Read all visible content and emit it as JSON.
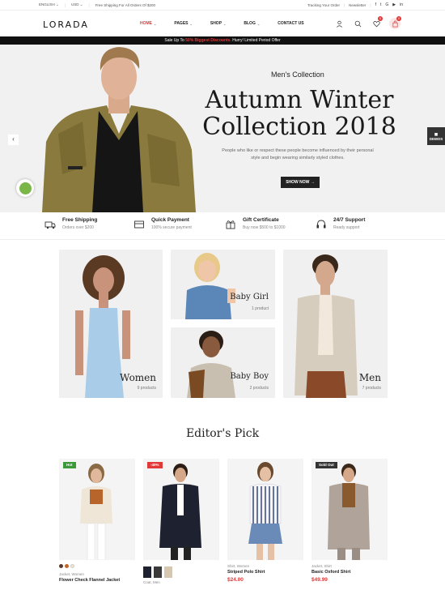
{
  "topbar": {
    "language": "ENGLISH",
    "currency": "USD",
    "shipping_note": "Free Shipping For All Orders Of $200",
    "tracking": "Tracking Your Order",
    "newsletter": "Newsletter",
    "social": [
      "f",
      "t",
      "G",
      "▶",
      "in"
    ]
  },
  "header": {
    "logo": "LORADA",
    "nav": [
      {
        "label": "HOME",
        "active": true
      },
      {
        "label": "PAGES"
      },
      {
        "label": "SHOP"
      },
      {
        "label": "BLOG"
      },
      {
        "label": "CONTACT US"
      }
    ],
    "wishlist_count": "0",
    "cart_count": "0"
  },
  "promo": {
    "prefix": "Sale Up To ",
    "highlight": "50% Biggest Discounts.",
    "suffix": " Hurry! Limited Period Offer"
  },
  "hero": {
    "subtitle": "Men's Collection",
    "title_line1": "Autumn Winter",
    "title_line2": "Collection 2018",
    "description": "People who like or respect these people become influenced by their personal style and begin wearing similarly styled clothes.",
    "button": "SHOW NOW →",
    "demos": "DEMOS"
  },
  "features": [
    {
      "title": "Free Shipping",
      "desc": "Orders over $200",
      "icon": "truck-icon"
    },
    {
      "title": "Quick Payment",
      "desc": "100% secure payment",
      "icon": "payment-icon"
    },
    {
      "title": "Gift Certificate",
      "desc": "Buy now $500 to $1000",
      "icon": "gift-icon"
    },
    {
      "title": "24/7 Support",
      "desc": "Ready support",
      "icon": "headset-icon"
    }
  ],
  "categories": {
    "women": {
      "label": "Women",
      "count": "9 products"
    },
    "baby_girl": {
      "label": "Baby Girl",
      "count": "1 product"
    },
    "baby_boy": {
      "label": "Baby Boy",
      "count": "2 products"
    },
    "men": {
      "label": "Men",
      "count": "7 products"
    }
  },
  "editors_pick": {
    "title": "Editor's Pick",
    "products": [
      {
        "tag": "Hot",
        "tag_color": "#3a9a3a",
        "cats": "Jacket, Women",
        "name": "Flower Check Flannel Jacket",
        "price": ""
      },
      {
        "tag": "-40%",
        "tag_color": "#e13838",
        "cats": "Coat, Men",
        "name": "",
        "price": ""
      },
      {
        "tag": "",
        "cats": "Shirt, Women",
        "name": "Striped Polo Shirt",
        "price": "$24.00"
      },
      {
        "tag": "Sold Out",
        "tag_color": "#333333",
        "cats": "Jacket, Shirt",
        "name": "Basic Oxford Shirt",
        "price": "$49.99"
      }
    ]
  },
  "colors": {
    "accent": "#e13838",
    "dark": "#222222",
    "hero_bg": "#f1f1f1"
  }
}
